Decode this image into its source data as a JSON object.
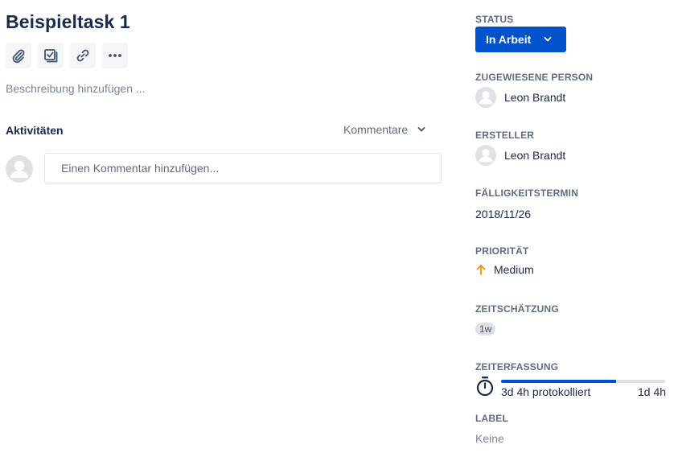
{
  "issue": {
    "title": "Beispieltask 1",
    "description_placeholder": "Beschreibung hinzufügen ...",
    "toolbar": [
      "attachment-icon",
      "subtask-icon",
      "link-icon",
      "more-icon"
    ]
  },
  "activity": {
    "title": "Aktivitäten",
    "filter_label": "Kommentare",
    "comment_placeholder": "Einen Kommentar hinzufügen..."
  },
  "sidebar": {
    "status": {
      "label": "STATUS",
      "value": "In Arbeit"
    },
    "assignee": {
      "label": "ZUGEWIESENE PERSON",
      "name": "Leon Brandt"
    },
    "reporter": {
      "label": "ERSTELLER",
      "name": "Leon Brandt"
    },
    "due_date": {
      "label": "FÄLLIGKEITSTERMIN",
      "value": "2018/11/26"
    },
    "priority": {
      "label": "PRIORITÄT",
      "value": "Medium",
      "color": "#ff8b00"
    },
    "estimate": {
      "label": "ZEITSCHÄTZUNG",
      "value": "1w"
    },
    "time_tracking": {
      "label": "ZEITERFASSUNG",
      "logged": "3d 4h protokolliert",
      "remaining": "1d 4h",
      "progress_fraction": 0.7
    },
    "labels": {
      "label": "LABEL",
      "value": "Keine"
    }
  },
  "colors": {
    "primary": "#0052cc",
    "text": "#172b4d",
    "muted": "#5e6c84"
  }
}
